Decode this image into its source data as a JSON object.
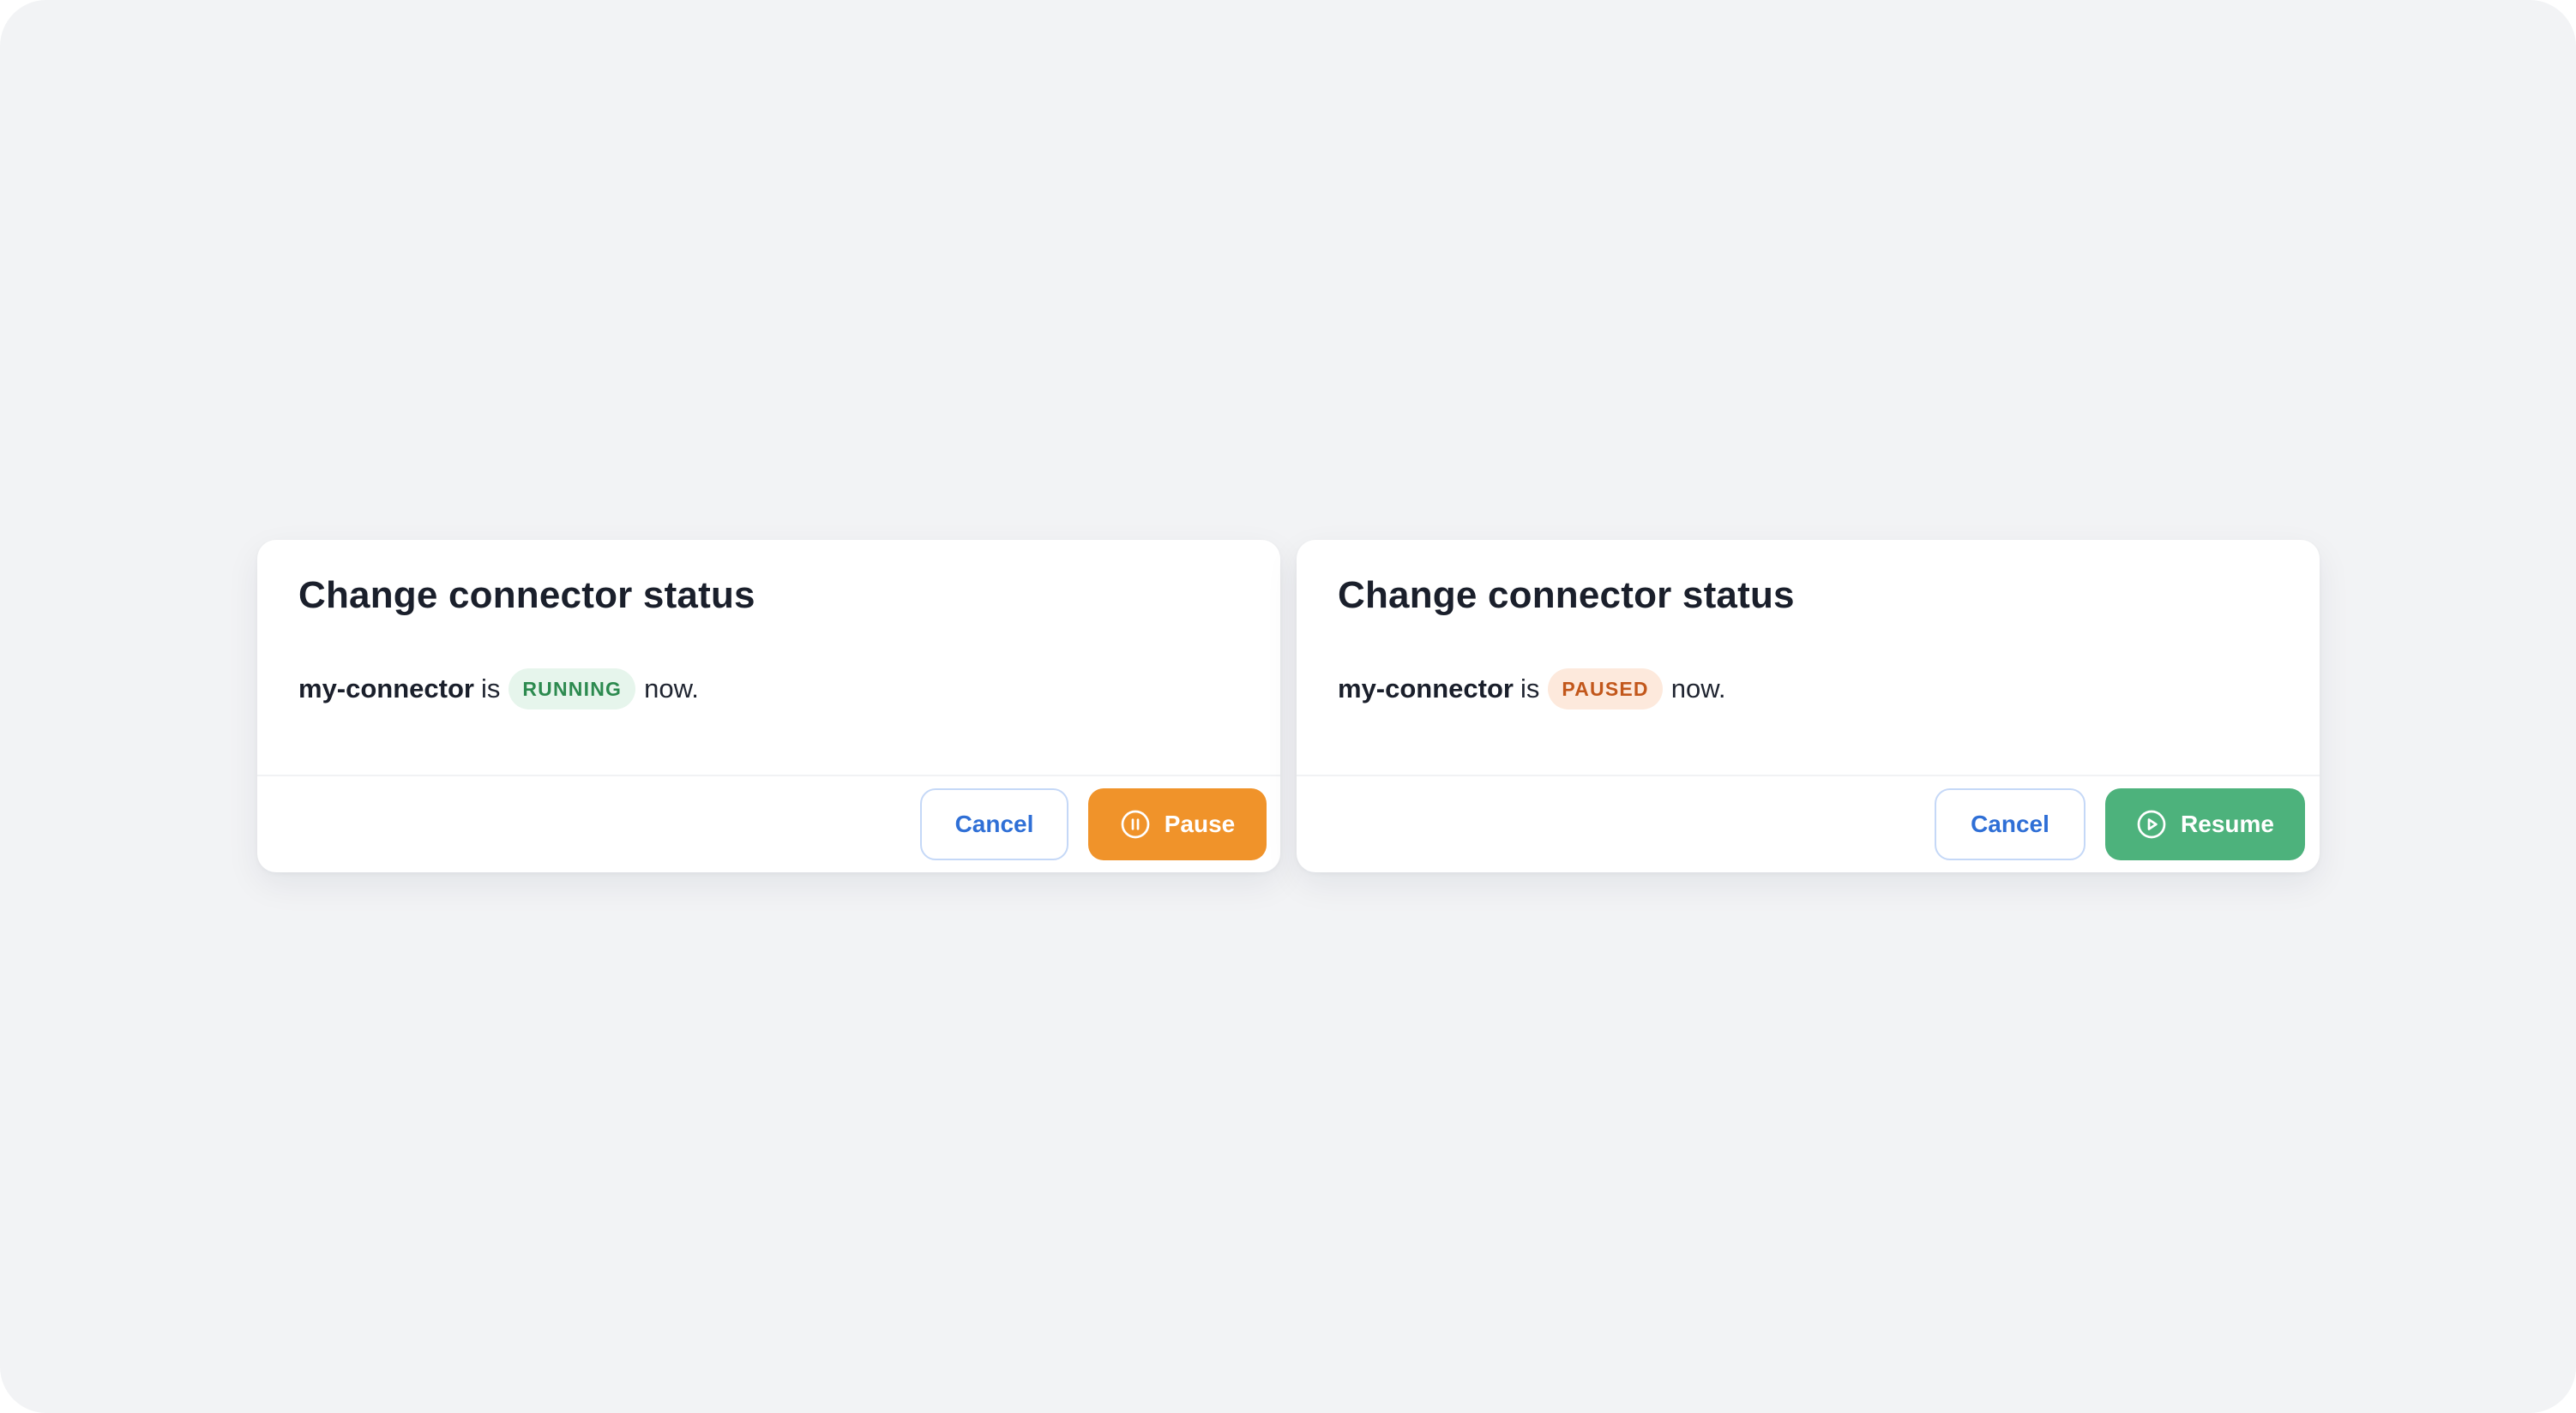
{
  "colors": {
    "page_background": "#f2f3f5",
    "pause_accent": "#f0932a",
    "resume_accent": "#4db27c",
    "cancel_text": "#2f6fd6",
    "running_badge_text": "#2c8a4f",
    "running_badge_bg": "#e6f5ec",
    "paused_badge_text": "#c2571b",
    "paused_badge_bg": "#fde9dc"
  },
  "dialogs": [
    {
      "title": "Change connector status",
      "connector_name": "my-connector",
      "is_text": "is",
      "status": "RUNNING",
      "now_text": "now.",
      "cancel_label": "Cancel",
      "action_label": "Pause",
      "action_icon": "pause-circle-icon"
    },
    {
      "title": "Change connector status",
      "connector_name": "my-connector",
      "is_text": "is",
      "status": "PAUSED",
      "now_text": "now.",
      "cancel_label": "Cancel",
      "action_label": "Resume",
      "action_icon": "play-circle-icon"
    }
  ]
}
